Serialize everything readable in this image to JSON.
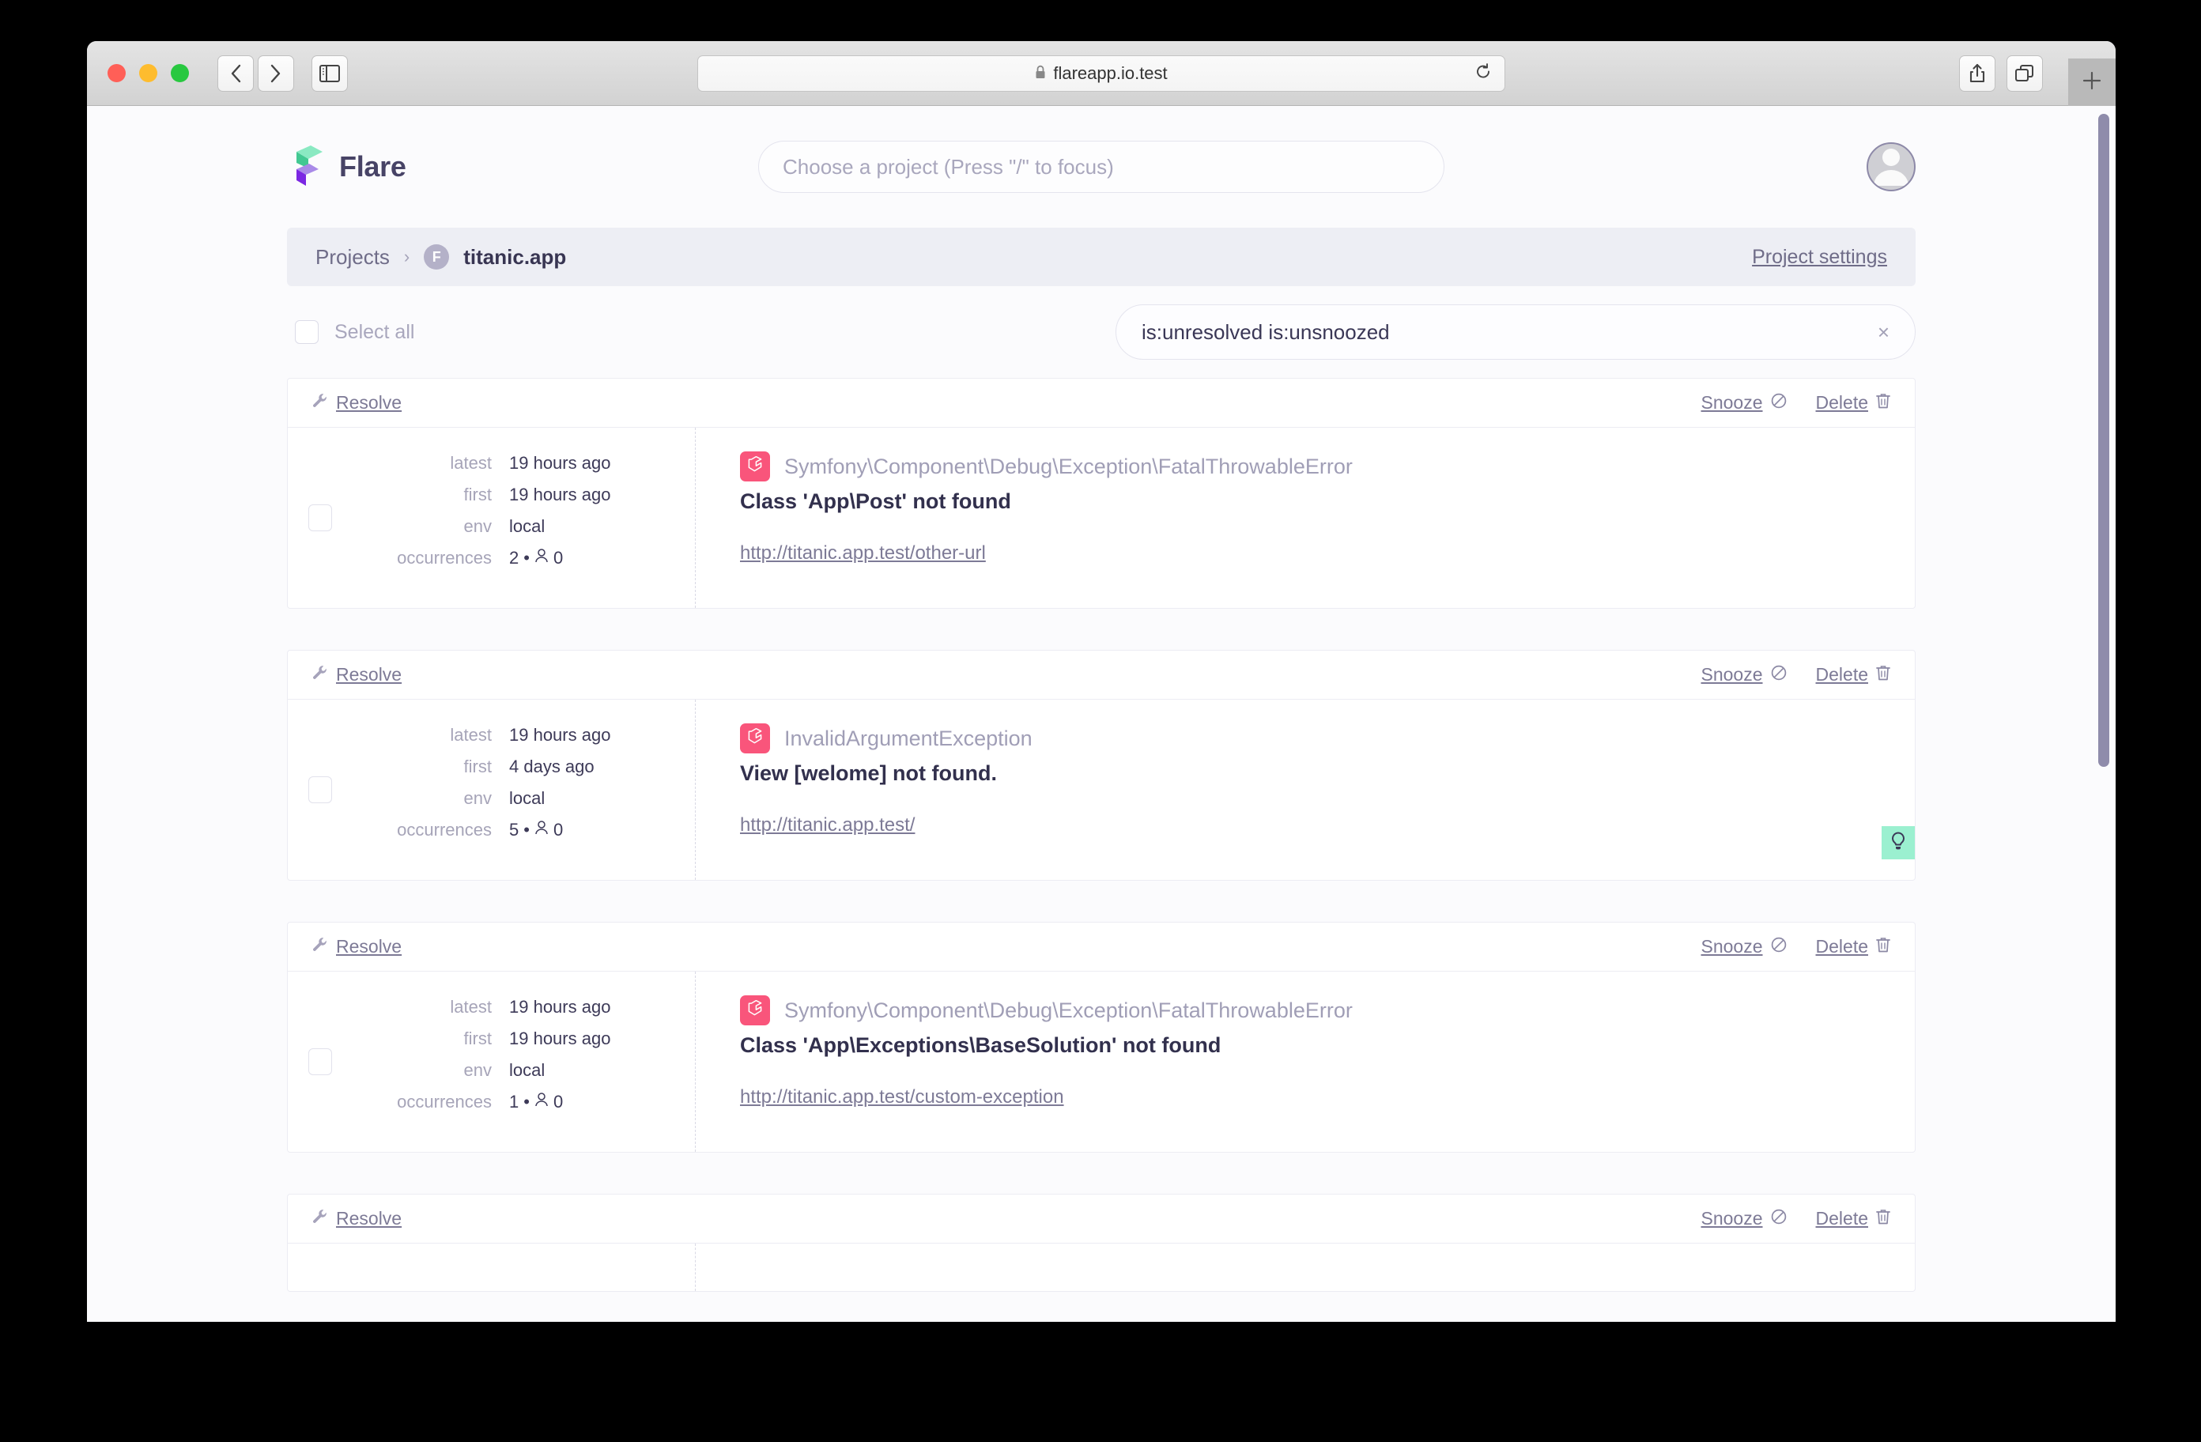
{
  "browser": {
    "url": "flareapp.io.test",
    "lock_icon": "lock-icon",
    "back_icon": "chevron-left-icon",
    "forward_icon": "chevron-right-icon",
    "sidebar_icon": "sidebar-toggle-icon",
    "reload_icon": "reload-icon",
    "share_icon": "share-icon",
    "tabs_icon": "tab-overview-icon",
    "newtab_icon": "plus-icon"
  },
  "header": {
    "brand_name": "Flare",
    "logo_icon": "flare-logo-icon",
    "project_picker_placeholder": "Choose a project (Press \"/\" to focus)",
    "avatar_icon": "user-avatar-icon"
  },
  "breadcrumb": {
    "projects_label": "Projects",
    "separator": "›",
    "project_initial": "F",
    "project_name": "titanic.app",
    "settings_label": "Project settings"
  },
  "filters": {
    "select_all_label": "Select all",
    "search_value": "is:unresolved is:unsnoozed",
    "clear_icon": "close-icon",
    "clear_label": "×"
  },
  "card_actions": {
    "resolve_label": "Resolve",
    "resolve_icon": "wrench-icon",
    "snooze_label": "Snooze",
    "snooze_icon": "ban-icon",
    "delete_label": "Delete",
    "delete_icon": "trash-icon"
  },
  "meta_labels": {
    "latest": "latest",
    "first": "first",
    "env": "env",
    "occurrences": "occurrences"
  },
  "colors": {
    "accent_purple": "#7c3aed",
    "accent_green": "#6ee7b7",
    "badge_pink": "#f9557b",
    "solution_green": "#9bf0d0",
    "text_dark": "#32304d",
    "text_muted": "#a09eb6",
    "link": "#7d7a96"
  },
  "errors": [
    {
      "latest": "19 hours ago",
      "first": "19 hours ago",
      "env": "local",
      "occurrences": "2",
      "users": "0",
      "separator": "•",
      "user_icon": "user-icon",
      "framework_icon": "laravel-icon",
      "exception_class": "Symfony\\Component\\Debug\\Exception\\FatalThrowableError",
      "message": "Class 'App\\Post' not found",
      "url": "http://titanic.app.test/other-url",
      "has_solution": false
    },
    {
      "latest": "19 hours ago",
      "first": "4 days ago",
      "env": "local",
      "occurrences": "5",
      "users": "0",
      "separator": "•",
      "user_icon": "user-icon",
      "framework_icon": "laravel-icon",
      "exception_class": "InvalidArgumentException",
      "message": "View [welome] not found.",
      "url": "http://titanic.app.test/",
      "has_solution": true,
      "solution_icon": "lightbulb-icon"
    },
    {
      "latest": "19 hours ago",
      "first": "19 hours ago",
      "env": "local",
      "occurrences": "1",
      "users": "0",
      "separator": "•",
      "user_icon": "user-icon",
      "framework_icon": "laravel-icon",
      "exception_class": "Symfony\\Component\\Debug\\Exception\\FatalThrowableError",
      "message": "Class 'App\\Exceptions\\BaseSolution' not found",
      "url": "http://titanic.app.test/custom-exception",
      "has_solution": false
    },
    {
      "latest": "",
      "first": "",
      "env": "",
      "occurrences": "",
      "users": "",
      "separator": "•",
      "user_icon": "user-icon",
      "framework_icon": "laravel-icon",
      "exception_class": "",
      "message": "",
      "url": "",
      "has_solution": false
    }
  ]
}
